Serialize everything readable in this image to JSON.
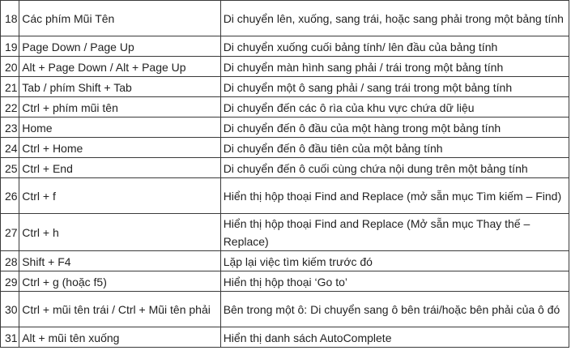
{
  "rows": [
    {
      "num": "18",
      "keys": "Các phím Mũi Tên",
      "desc": "Di chuyển lên, xuống, sang trái, hoặc sang phải trong một bảng tính",
      "tall": true
    },
    {
      "num": "19",
      "keys": "Page Down / Page Up",
      "desc": "Di chuyển xuống cuối bảng tính/ lên đầu của bảng tính",
      "tall": false
    },
    {
      "num": "20",
      "keys": "Alt + Page Down / Alt + Page Up",
      "desc": "Di chuyển màn hình sang phải / trái trong một bảng tính",
      "tall": false
    },
    {
      "num": "21",
      "keys": "Tab / phím Shift + Tab",
      "desc": "Di chuyển một ô sang phải / sang trái trong một bảng tính",
      "tall": false
    },
    {
      "num": "22",
      "keys": "Ctrl + phím mũi tên",
      "desc": "Di chuyển đến các ô rìa của khu vực chứa dữ liệu",
      "tall": false
    },
    {
      "num": "23",
      "keys": "Home",
      "desc": "Di chuyển đến ô đầu của một hàng trong một bảng tính",
      "tall": false
    },
    {
      "num": "24",
      "keys": "Ctrl + Home",
      "desc": "Di chuyển đến ô đầu tiên của một bảng tính",
      "tall": false
    },
    {
      "num": "25",
      "keys": "Ctrl + End",
      "desc": "Di chuyển đến ô cuối cùng chứa nội dung trên một bảng tính",
      "tall": false
    },
    {
      "num": "26",
      "keys": "Ctrl + f",
      "desc": "Hiển thị hộp thoại Find and Replace (mở sẵn mục Tìm kiếm – Find)",
      "tall": true
    },
    {
      "num": "27",
      "keys": "Ctrl + h",
      "desc": "Hiển thị hộp thoại Find and Replace (Mở sẵn mục Thay thế – Replace)",
      "tall": true
    },
    {
      "num": "28",
      "keys": "Shift + F4",
      "desc": "Lặp lại việc tìm kiếm trước đó",
      "tall": false
    },
    {
      "num": "29",
      "keys": "Ctrl + g (hoặc f5)",
      "desc": "Hiển thị hộp thoại ‘Go to’",
      "tall": false
    },
    {
      "num": "30",
      "keys": "Ctrl + mũi tên trái / Ctrl + Mũi tên phải",
      "desc": "Bên trong một ô: Di chuyển sang ô bên trái/hoặc bên phải của ô đó",
      "tall": true
    },
    {
      "num": "31",
      "keys": "Alt + mũi tên xuống",
      "desc": "Hiển thị danh sách AutoComplete",
      "tall": false
    }
  ]
}
